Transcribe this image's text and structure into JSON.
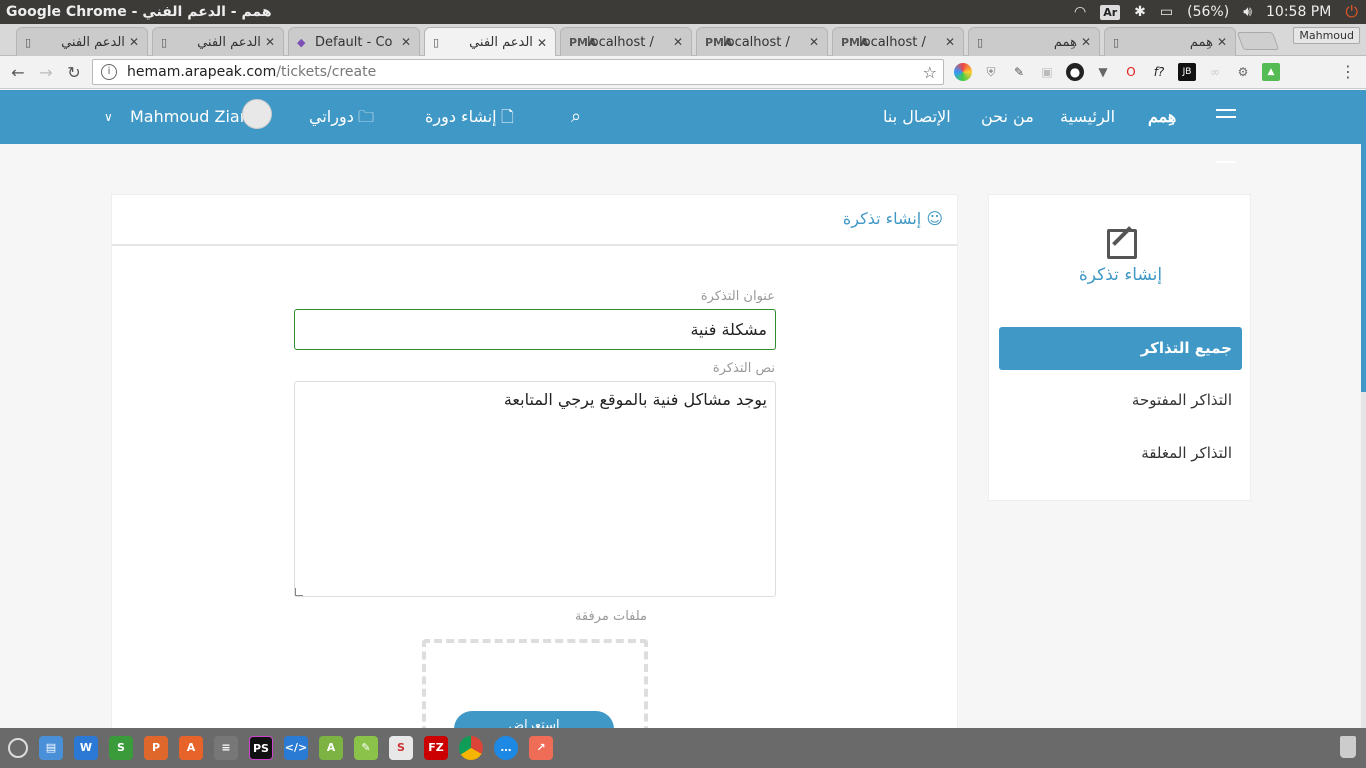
{
  "os": {
    "window_title": "Google Chrome - همم - الدعم الفني",
    "keyboard": "Ar",
    "battery": "(56%)",
    "time": "10:58 PM"
  },
  "tabs": [
    {
      "label": "الدعم الفني",
      "icon": "page-icon"
    },
    {
      "label": "الدعم الفني",
      "icon": "page-icon"
    },
    {
      "label": "Default - Co",
      "icon": "cube-icon"
    },
    {
      "label": "الدعم الفني",
      "icon": "page-icon",
      "active": true
    },
    {
      "label": "localhost /",
      "icon": "pma-icon"
    },
    {
      "label": "localhost /",
      "icon": "pma-icon"
    },
    {
      "label": "localhost /",
      "icon": "pma-icon"
    },
    {
      "label": "هِمم",
      "icon": "page-icon"
    },
    {
      "label": "هِمم",
      "icon": "page-icon"
    }
  ],
  "profile_name": "Mahmoud",
  "address": {
    "host": "hemam.arapeak.com",
    "path": "/tickets/create"
  },
  "site": {
    "logo": "هِمم",
    "nav": {
      "home": "الرئيسية",
      "about": "من نحن",
      "contact": "الإتصال بنا",
      "create_course": "إنشاء دورة",
      "my_courses": "دوراتي",
      "user_name": "Mahmoud Ziara"
    },
    "colors": {
      "primary": "#4098c6"
    }
  },
  "form": {
    "header": "إنشاء تذكرة",
    "title_label": "عنوان التذكرة",
    "title_value": "مشكلة فنية",
    "body_label": "نص التذكرة",
    "body_value": "يوجد مشاكل فنية بالموقع يرجي المتابعة",
    "attachments_label": "ملفات مرفقة",
    "browse_label": "استعراض"
  },
  "sidebar": {
    "create_label": "إنشاء تذكرة",
    "links": [
      {
        "label": "جميع التذاكر",
        "active": true
      },
      {
        "label": "التذاكر المفتوحة"
      },
      {
        "label": "التذاكر المغلقة"
      }
    ]
  }
}
